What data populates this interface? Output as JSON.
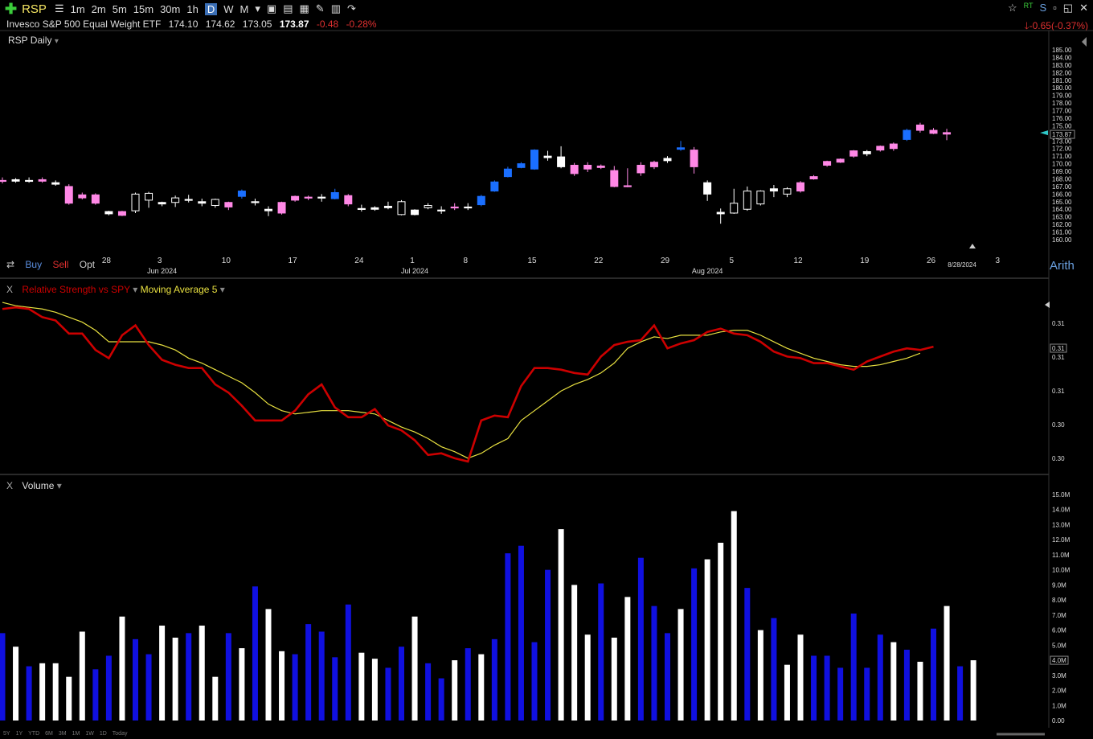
{
  "toolbar": {
    "symbol": "RSP",
    "intervals": [
      "1m",
      "2m",
      "5m",
      "15m",
      "30m",
      "1h",
      "D",
      "W",
      "M"
    ],
    "active_interval": "D"
  },
  "header": {
    "name": "Invesco S&P 500 Equal Weight ETF",
    "open": "174.10",
    "high": "174.62",
    "low": "173.05",
    "last": "173.87",
    "change": "-0.48",
    "change_pct": "-0.28%",
    "right_change": "-0.65(-0.37%)"
  },
  "chart_title": "RSP Daily",
  "trade": {
    "buy": "Buy",
    "sell": "Sell",
    "opt": "Opt"
  },
  "scale_mode": "Arith",
  "price_axis_labels": [
    "185.00",
    "184.00",
    "183.00",
    "182.00",
    "181.00",
    "180.00",
    "179.00",
    "178.00",
    "177.00",
    "176.00",
    "175.00",
    "174.00",
    "173.00",
    "172.00",
    "171.00",
    "170.00",
    "169.00",
    "168.00",
    "167.00",
    "166.00",
    "165.00",
    "164.00",
    "163.00",
    "162.00",
    "161.00",
    "160.00"
  ],
  "last_price_tag": "173.87",
  "date_tag": "8/28/2024",
  "x_day_labels": [
    "28",
    "3",
    "10",
    "17",
    "24",
    "1",
    "8",
    "15",
    "22",
    "29",
    "5",
    "12",
    "19",
    "26",
    "3"
  ],
  "x_month_labels": [
    "Jun 2024",
    "Jul 2024",
    "Aug 2024"
  ],
  "rs_panel": {
    "close_x": "X",
    "title": "Relative Strength vs SPY",
    "ma_title": "Moving Average 5",
    "axis_labels": [
      "0.31",
      "0.31",
      "0.31",
      "0.30",
      "0.30"
    ],
    "tag": "0.31"
  },
  "volume_panel": {
    "close_x": "X",
    "title": "Volume",
    "axis_labels": [
      "15.0M",
      "14.0M",
      "13.0M",
      "12.0M",
      "11.0M",
      "10.0M",
      "9.0M",
      "8.0M",
      "7.0M",
      "6.0M",
      "5.0M",
      "4.0M",
      "3.0M",
      "2.0M",
      "1.0M",
      "0.00"
    ],
    "tag": "4.0M"
  },
  "range_buttons": [
    "5Y",
    "1Y",
    "YTD",
    "6M",
    "3M",
    "1M",
    "1W",
    "1D",
    "Today"
  ],
  "colors": {
    "up_white": "#ffffff",
    "up_blue": "#1a6fff",
    "down_pink": "#ff88e6",
    "rs_line": "#cc0000",
    "ma_line": "#e8e040",
    "vol_blue": "#1010e0",
    "vol_white": "#ffffff"
  },
  "chart_data": [
    {
      "type": "candlestick",
      "title": "RSP Daily",
      "ylim": [
        160,
        185
      ],
      "candles": [
        {
          "o": 167.8,
          "h": 168.2,
          "l": 167.4,
          "c": 167.8,
          "k": "pink"
        },
        {
          "o": 167.9,
          "h": 168.1,
          "l": 167.5,
          "c": 167.7,
          "k": "white"
        },
        {
          "o": 167.8,
          "h": 168.2,
          "l": 167.5,
          "c": 167.8,
          "k": "white"
        },
        {
          "o": 167.9,
          "h": 168.2,
          "l": 167.5,
          "c": 167.7,
          "k": "pink"
        },
        {
          "o": 167.5,
          "h": 167.8,
          "l": 167.1,
          "c": 167.3,
          "k": "white"
        },
        {
          "o": 167.0,
          "h": 167.3,
          "l": 164.6,
          "c": 164.8,
          "k": "pink"
        },
        {
          "o": 165.9,
          "h": 166.2,
          "l": 165.3,
          "c": 165.5,
          "k": "pink"
        },
        {
          "o": 165.9,
          "h": 166.1,
          "l": 164.6,
          "c": 164.8,
          "k": "pink"
        },
        {
          "o": 163.4,
          "h": 163.8,
          "l": 163.2,
          "c": 163.7,
          "k": "white"
        },
        {
          "o": 163.2,
          "h": 163.8,
          "l": 163.1,
          "c": 163.7,
          "k": "pink"
        },
        {
          "o": 163.8,
          "h": 166.2,
          "l": 163.5,
          "c": 166.0,
          "k": "white"
        },
        {
          "o": 165.2,
          "h": 166.3,
          "l": 164.2,
          "c": 166.1,
          "k": "white"
        },
        {
          "o": 164.7,
          "h": 165.0,
          "l": 164.4,
          "c": 164.9,
          "k": "white"
        },
        {
          "o": 164.9,
          "h": 165.8,
          "l": 164.3,
          "c": 165.5,
          "k": "white"
        },
        {
          "o": 165.3,
          "h": 165.9,
          "l": 164.9,
          "c": 165.3,
          "k": "white"
        },
        {
          "o": 165.0,
          "h": 165.4,
          "l": 164.4,
          "c": 164.8,
          "k": "white"
        },
        {
          "o": 164.5,
          "h": 165.4,
          "l": 164.2,
          "c": 165.3,
          "k": "white"
        },
        {
          "o": 164.9,
          "h": 165.0,
          "l": 163.9,
          "c": 164.3,
          "k": "pink"
        },
        {
          "o": 165.7,
          "h": 166.6,
          "l": 165.4,
          "c": 166.4,
          "k": "blue"
        },
        {
          "o": 165.0,
          "h": 165.4,
          "l": 164.5,
          "c": 164.9,
          "k": "white"
        },
        {
          "o": 163.8,
          "h": 164.4,
          "l": 163.1,
          "c": 164.0,
          "k": "white"
        },
        {
          "o": 163.5,
          "h": 165.0,
          "l": 163.3,
          "c": 164.9,
          "k": "pink"
        },
        {
          "o": 165.2,
          "h": 165.8,
          "l": 165.0,
          "c": 165.7,
          "k": "pink"
        },
        {
          "o": 165.5,
          "h": 165.8,
          "l": 165.2,
          "c": 165.6,
          "k": "pink"
        },
        {
          "o": 165.6,
          "h": 166.0,
          "l": 165.0,
          "c": 165.6,
          "k": "white"
        },
        {
          "o": 165.4,
          "h": 166.7,
          "l": 165.3,
          "c": 166.2,
          "k": "blue"
        },
        {
          "o": 164.7,
          "h": 166.0,
          "l": 164.4,
          "c": 165.8,
          "k": "pink"
        },
        {
          "o": 164.1,
          "h": 164.6,
          "l": 163.7,
          "c": 164.0,
          "k": "white"
        },
        {
          "o": 164.0,
          "h": 164.4,
          "l": 163.8,
          "c": 164.2,
          "k": "white"
        },
        {
          "o": 164.4,
          "h": 165.0,
          "l": 164.0,
          "c": 164.2,
          "k": "white"
        },
        {
          "o": 163.3,
          "h": 165.2,
          "l": 163.2,
          "c": 165.0,
          "k": "white"
        },
        {
          "o": 163.9,
          "h": 164.0,
          "l": 163.2,
          "c": 163.3,
          "k": "white"
        },
        {
          "o": 164.2,
          "h": 164.8,
          "l": 164.0,
          "c": 164.5,
          "k": "white"
        },
        {
          "o": 163.8,
          "h": 164.4,
          "l": 163.4,
          "c": 163.9,
          "k": "white"
        },
        {
          "o": 164.2,
          "h": 164.8,
          "l": 163.9,
          "c": 164.3,
          "k": "pink"
        },
        {
          "o": 164.2,
          "h": 164.8,
          "l": 163.9,
          "c": 164.3,
          "k": "white"
        },
        {
          "o": 164.6,
          "h": 165.9,
          "l": 164.4,
          "c": 165.7,
          "k": "blue"
        },
        {
          "o": 166.4,
          "h": 167.8,
          "l": 166.3,
          "c": 167.6,
          "k": "blue"
        },
        {
          "o": 168.3,
          "h": 169.6,
          "l": 168.2,
          "c": 169.3,
          "k": "blue"
        },
        {
          "o": 169.5,
          "h": 170.2,
          "l": 169.4,
          "c": 170.0,
          "k": "blue"
        },
        {
          "o": 169.3,
          "h": 171.9,
          "l": 169.2,
          "c": 171.8,
          "k": "blue"
        },
        {
          "o": 171.0,
          "h": 171.7,
          "l": 170.4,
          "c": 170.8,
          "k": "white"
        },
        {
          "o": 170.9,
          "h": 172.3,
          "l": 169.4,
          "c": 169.6,
          "k": "white"
        },
        {
          "o": 168.7,
          "h": 170.1,
          "l": 168.4,
          "c": 169.8,
          "k": "pink"
        },
        {
          "o": 169.8,
          "h": 170.2,
          "l": 168.9,
          "c": 169.3,
          "k": "pink"
        },
        {
          "o": 169.5,
          "h": 169.9,
          "l": 169.3,
          "c": 169.7,
          "k": "pink"
        },
        {
          "o": 167.0,
          "h": 169.7,
          "l": 166.9,
          "c": 169.1,
          "k": "pink"
        },
        {
          "o": 167.0,
          "h": 169.4,
          "l": 166.9,
          "c": 167.1,
          "k": "pink"
        },
        {
          "o": 168.8,
          "h": 170.2,
          "l": 168.4,
          "c": 169.8,
          "k": "pink"
        },
        {
          "o": 169.6,
          "h": 170.4,
          "l": 169.3,
          "c": 170.2,
          "k": "pink"
        },
        {
          "o": 170.4,
          "h": 171.0,
          "l": 170.1,
          "c": 170.7,
          "k": "white"
        },
        {
          "o": 171.9,
          "h": 173.0,
          "l": 171.7,
          "c": 172.1,
          "k": "blue"
        },
        {
          "o": 169.6,
          "h": 172.2,
          "l": 168.7,
          "c": 171.8,
          "k": "pink"
        },
        {
          "o": 167.5,
          "h": 167.8,
          "l": 165.1,
          "c": 166.0,
          "k": "white"
        },
        {
          "o": 163.4,
          "h": 164.1,
          "l": 162.1,
          "c": 163.6,
          "k": "white"
        },
        {
          "o": 163.5,
          "h": 166.7,
          "l": 163.4,
          "c": 164.8,
          "k": "white"
        },
        {
          "o": 164.0,
          "h": 167.0,
          "l": 163.8,
          "c": 166.4,
          "k": "white"
        },
        {
          "o": 164.7,
          "h": 166.5,
          "l": 164.5,
          "c": 166.4,
          "k": "white"
        },
        {
          "o": 166.4,
          "h": 167.2,
          "l": 165.6,
          "c": 166.7,
          "k": "white"
        },
        {
          "o": 166.0,
          "h": 166.9,
          "l": 165.6,
          "c": 166.7,
          "k": "white"
        },
        {
          "o": 166.4,
          "h": 167.7,
          "l": 166.2,
          "c": 167.5,
          "k": "pink"
        },
        {
          "o": 168.0,
          "h": 168.5,
          "l": 167.9,
          "c": 168.3,
          "k": "pink"
        },
        {
          "o": 169.8,
          "h": 170.4,
          "l": 169.6,
          "c": 170.3,
          "k": "pink"
        },
        {
          "o": 170.2,
          "h": 170.7,
          "l": 170.1,
          "c": 170.6,
          "k": "pink"
        },
        {
          "o": 171.0,
          "h": 171.8,
          "l": 170.8,
          "c": 171.7,
          "k": "pink"
        },
        {
          "o": 171.3,
          "h": 171.8,
          "l": 171.0,
          "c": 171.6,
          "k": "white"
        },
        {
          "o": 171.8,
          "h": 172.4,
          "l": 171.6,
          "c": 172.3,
          "k": "pink"
        },
        {
          "o": 172.0,
          "h": 172.8,
          "l": 171.7,
          "c": 172.6,
          "k": "pink"
        },
        {
          "o": 173.2,
          "h": 174.6,
          "l": 173.0,
          "c": 174.4,
          "k": "blue"
        },
        {
          "o": 174.4,
          "h": 175.4,
          "l": 174.1,
          "c": 175.1,
          "k": "pink"
        },
        {
          "o": 174.4,
          "h": 174.7,
          "l": 173.9,
          "c": 174.0,
          "k": "pink"
        },
        {
          "o": 174.1,
          "h": 174.6,
          "l": 173.1,
          "c": 173.9,
          "k": "pink"
        }
      ]
    },
    {
      "type": "line",
      "title": "Relative Strength vs SPY",
      "series": [
        {
          "name": "Relative Strength vs SPY",
          "values": [
            0.3126,
            0.3127,
            0.3126,
            0.3121,
            0.3119,
            0.3111,
            0.3111,
            0.3101,
            0.3096,
            0.311,
            0.3116,
            0.3104,
            0.3095,
            0.3092,
            0.309,
            0.309,
            0.308,
            0.3075,
            0.3067,
            0.3058,
            0.3058,
            0.3058,
            0.3064,
            0.3074,
            0.308,
            0.3066,
            0.306,
            0.306,
            0.3065,
            0.3055,
            0.3052,
            0.3046,
            0.3037,
            0.3038,
            0.3035,
            0.3033,
            0.3058,
            0.3061,
            0.306,
            0.3079,
            0.309,
            0.309,
            0.3089,
            0.3087,
            0.3086,
            0.3097,
            0.3104,
            0.3106,
            0.3107,
            0.3116,
            0.3102,
            0.3105,
            0.3107,
            0.3112,
            0.3114,
            0.3111,
            0.311,
            0.3106,
            0.31,
            0.3097,
            0.3096,
            0.3093,
            0.3093,
            0.3091,
            0.3089,
            0.3094,
            0.3097,
            0.31,
            0.3102,
            0.3101,
            0.3103
          ]
        },
        {
          "name": "Moving Average 5",
          "values": [
            0.313,
            0.3128,
            0.3127,
            0.3126,
            0.3124,
            0.3121,
            0.3118,
            0.3113,
            0.3106,
            0.3106,
            0.3106,
            0.3106,
            0.3104,
            0.3101,
            0.3096,
            0.3093,
            0.3089,
            0.3085,
            0.3081,
            0.3075,
            0.3068,
            0.3064,
            0.3062,
            0.3063,
            0.3064,
            0.3064,
            0.3064,
            0.3063,
            0.3062,
            0.3058,
            0.3054,
            0.3051,
            0.3047,
            0.3042,
            0.3039,
            0.3035,
            0.3038,
            0.3043,
            0.3047,
            0.3058,
            0.3064,
            0.307,
            0.3076,
            0.308,
            0.3083,
            0.3087,
            0.3093,
            0.3102,
            0.3106,
            0.3109,
            0.3108,
            0.311,
            0.311,
            0.311,
            0.3112,
            0.3113,
            0.3113,
            0.311,
            0.3106,
            0.3102,
            0.3099,
            0.3096,
            0.3094,
            0.3092,
            0.3091,
            0.3091,
            0.3092,
            0.3094,
            0.3096,
            0.3099
          ]
        }
      ]
    },
    {
      "type": "bar",
      "title": "Volume",
      "ylim": [
        0,
        15
      ],
      "unit": "M",
      "values": [
        5.8,
        4.9,
        3.6,
        3.8,
        3.8,
        2.9,
        5.9,
        3.4,
        4.3,
        6.9,
        5.4,
        4.4,
        6.3,
        5.5,
        5.8,
        6.3,
        2.9,
        5.8,
        4.8,
        8.9,
        7.4,
        4.6,
        4.4,
        6.4,
        5.9,
        4.2,
        7.7,
        4.5,
        4.1,
        3.5,
        4.9,
        6.9,
        3.8,
        2.8,
        4.0,
        4.8,
        4.4,
        5.4,
        11.1,
        11.6,
        5.2,
        10.0,
        12.7,
        9.0,
        5.7,
        9.1,
        5.5,
        8.2,
        10.8,
        7.6,
        5.8,
        7.4,
        10.1,
        10.7,
        11.8,
        13.9,
        8.8,
        6.0,
        6.8,
        3.7,
        5.7,
        4.3,
        4.3,
        3.5,
        7.1,
        3.5,
        5.7,
        5.2,
        4.7,
        3.9,
        6.1,
        7.6,
        3.6,
        4.0
      ],
      "colors": [
        "blue",
        "white",
        "blue",
        "white",
        "white",
        "white",
        "white",
        "blue",
        "blue",
        "white",
        "blue",
        "blue",
        "white",
        "white",
        "blue",
        "white",
        "white",
        "blue",
        "white",
        "blue",
        "white",
        "white",
        "blue",
        "blue",
        "blue",
        "blue",
        "blue",
        "white",
        "white",
        "blue",
        "blue",
        "white",
        "blue",
        "blue",
        "white",
        "blue",
        "white",
        "blue",
        "blue",
        "blue",
        "blue",
        "blue",
        "white",
        "white",
        "white",
        "blue",
        "white",
        "white",
        "blue",
        "blue",
        "blue",
        "white",
        "blue",
        "white",
        "white",
        "white",
        "blue",
        "white",
        "blue",
        "white",
        "white",
        "blue",
        "blue",
        "blue",
        "blue",
        "blue",
        "blue",
        "white",
        "blue",
        "white",
        "blue",
        "white",
        "blue",
        "white"
      ]
    }
  ]
}
